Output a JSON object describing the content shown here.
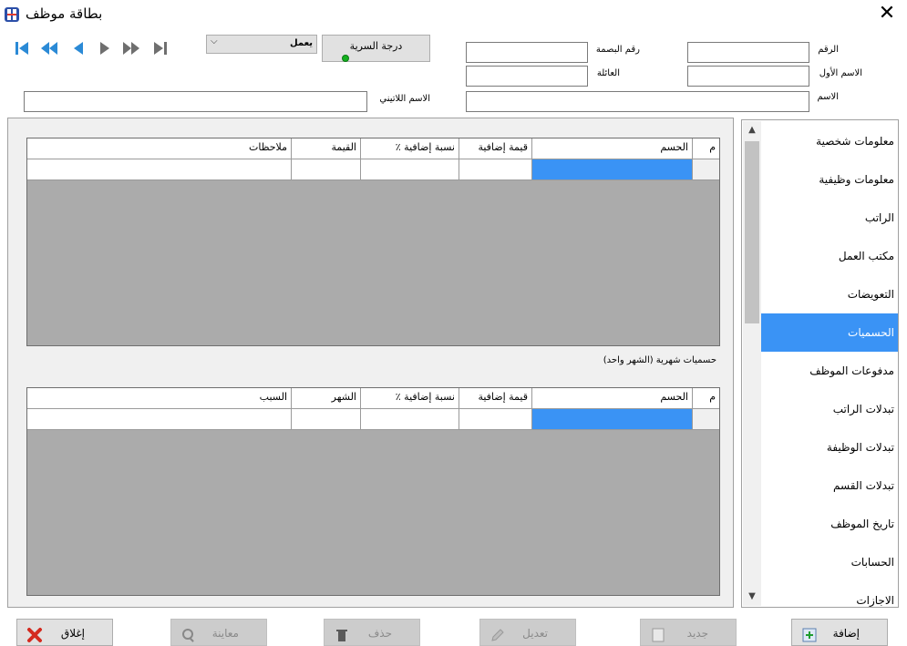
{
  "window": {
    "title": "بطاقة موظف",
    "close_glyph": "✕"
  },
  "toolbar": {
    "nav_icons": [
      "first-record-icon",
      "fast-backward-icon",
      "previous-record-icon",
      "next-record-icon",
      "fast-forward-icon",
      "last-record-icon"
    ],
    "status": {
      "value": "يعمل",
      "options_visible": [
        "يعمل"
      ]
    },
    "secrecy_button": {
      "label": "درجة السرية",
      "indicator_color": "#13b01e"
    }
  },
  "form": {
    "number_label": "الرقم",
    "number_value": "",
    "fingerprint_label": "رقم البصمة",
    "fingerprint_value": "",
    "first_name_label": "الاسم الأول",
    "first_name_value": "",
    "family_label": "العائلة",
    "family_value": "",
    "name_label": "الاسم",
    "name_value": "",
    "latin_name_label": "الاسم اللاتيني",
    "latin_name_value": ""
  },
  "deductions_grid": {
    "columns": [
      "م",
      "الحسم",
      "قيمة إضافية",
      "نسبة إضافية ٪",
      "القيمة",
      "ملاحظات"
    ],
    "rows": [
      [
        "",
        "",
        "",
        "",
        "",
        ""
      ]
    ]
  },
  "monthly_caption": "حسميات شهرية (الشهر واحد)",
  "monthly_grid": {
    "columns": [
      "م",
      "الحسم",
      "قيمة إضافية",
      "نسبة إضافية ٪",
      "الشهر",
      "السبب"
    ],
    "rows": [
      [
        "",
        "",
        "",
        "",
        "",
        ""
      ]
    ]
  },
  "tabs": [
    {
      "label": "معلومات شخصية",
      "active": false
    },
    {
      "label": "معلومات وظيفية",
      "active": false
    },
    {
      "label": "الراتب",
      "active": false
    },
    {
      "label": "مكتب العمل",
      "active": false
    },
    {
      "label": "التعويضات",
      "active": false
    },
    {
      "label": "الحسميات",
      "active": true
    },
    {
      "label": "مدفوعات الموظف",
      "active": false
    },
    {
      "label": "تبدلات الراتب",
      "active": false
    },
    {
      "label": "تبدلات الوظيفة",
      "active": false
    },
    {
      "label": "تبدلات القسم",
      "active": false
    },
    {
      "label": "تاريخ الموظف",
      "active": false
    },
    {
      "label": "الحسابات",
      "active": false
    },
    {
      "label": "الاجازات",
      "active": false
    }
  ],
  "buttons": {
    "add": {
      "label": "إضافة",
      "icon": "add-record-icon",
      "enabled": true
    },
    "new": {
      "label": "جديد",
      "icon": "new-document-icon",
      "enabled": false
    },
    "edit": {
      "label": "تعديل",
      "icon": "edit-icon",
      "enabled": false
    },
    "delete": {
      "label": "حذف",
      "icon": "trash-icon",
      "enabled": false
    },
    "preview": {
      "label": "معاينة",
      "icon": "preview-icon",
      "enabled": false
    },
    "close": {
      "label": "إغلاق",
      "icon": "close-x-icon",
      "enabled": true
    }
  },
  "colors": {
    "selection_blue": "#3a93f5",
    "grid_empty": "#ababab",
    "panel_bg": "#f0f0f0"
  }
}
